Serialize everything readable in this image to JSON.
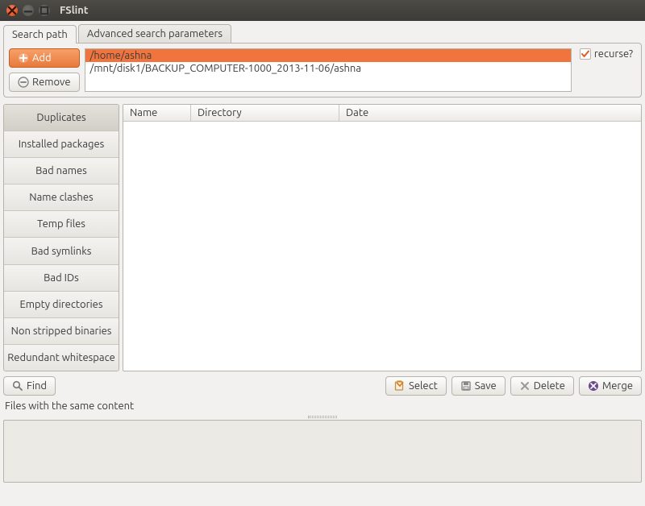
{
  "window": {
    "title": "FSlint"
  },
  "tabs": {
    "search_path": "Search path",
    "advanced": "Advanced search parameters"
  },
  "path_panel": {
    "add": "Add",
    "remove": "Remove",
    "paths": [
      "/home/ashna",
      "/mnt/disk1/BACKUP_COMPUTER-1000_2013-11-06/ashna"
    ],
    "recurse_label": "recurse?",
    "recurse_checked": true
  },
  "categories": [
    "Duplicates",
    "Installed packages",
    "Bad names",
    "Name clashes",
    "Temp files",
    "Bad symlinks",
    "Bad IDs",
    "Empty directories",
    "Non stripped binaries",
    "Redundant whitespace"
  ],
  "columns": {
    "name": "Name",
    "directory": "Directory",
    "date": "Date"
  },
  "actions": {
    "find": "Find",
    "select": "Select",
    "save": "Save",
    "delete": "Delete",
    "merge": "Merge"
  },
  "status": "Files with the same content",
  "colors": {
    "accent": "#f0743e"
  }
}
